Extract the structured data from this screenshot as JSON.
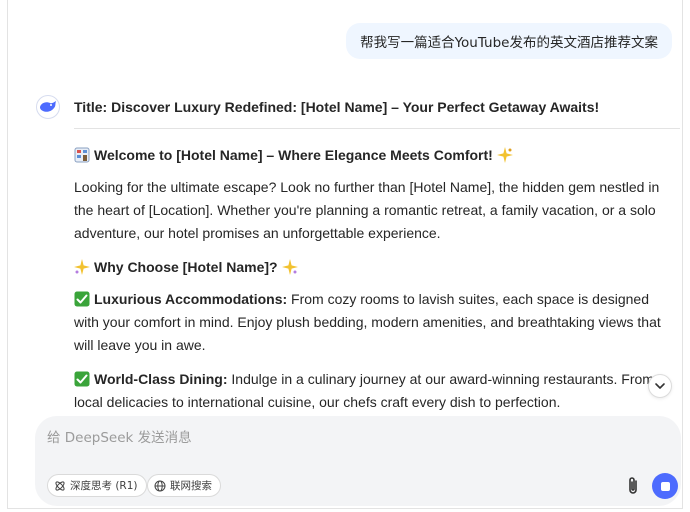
{
  "user_message": "帮我写一篇适合YouTube发布的英文酒店推荐文案",
  "response": {
    "title": "Title: Discover Luxury Redefined: [Hotel Name] – Your Perfect Getaway Awaits!",
    "welcome_heading": "Welcome to [Hotel Name] – Where Elegance Meets Comfort!",
    "intro": "Looking for the ultimate escape? Look no further than [Hotel Name], the hidden gem nestled in the heart of [Location]. Whether you're planning a romantic retreat, a family vacation, or a solo adventure, our hotel promises an unforgettable experience.",
    "why_heading": "Why Choose [Hotel Name]?",
    "features": [
      {
        "label": "Luxurious Accommodations:",
        "text": " From cozy rooms to lavish suites, each space is designed with your comfort in mind. Enjoy plush bedding, modern amenities, and breathtaking views that will leave you in awe."
      },
      {
        "label": "World-Class Dining:",
        "text": " Indulge in a culinary journey at our award-winning restaurants. From local delicacies to international cuisine, our chefs craft every dish to perfection."
      }
    ]
  },
  "composer": {
    "placeholder": "给 DeepSeek 发送消息",
    "chip_deepthink": "深度思考 (R1)",
    "chip_search": "联网搜索"
  },
  "colors": {
    "accent": "#4d6bfe",
    "user_bubble": "#eff6ff",
    "composer_bg": "#f3f4f6",
    "check_green": "#3aa43a"
  },
  "icons": {
    "avatar": "deepseek-whale-icon",
    "welcome": "hotel-icon",
    "why": "sparkles-icon",
    "feature": "check-mark-icon",
    "scroll": "chevron-down-icon",
    "attach": "paperclip-icon",
    "send": "stop-icon",
    "deepthink": "atom-icon",
    "search": "globe-icon"
  }
}
